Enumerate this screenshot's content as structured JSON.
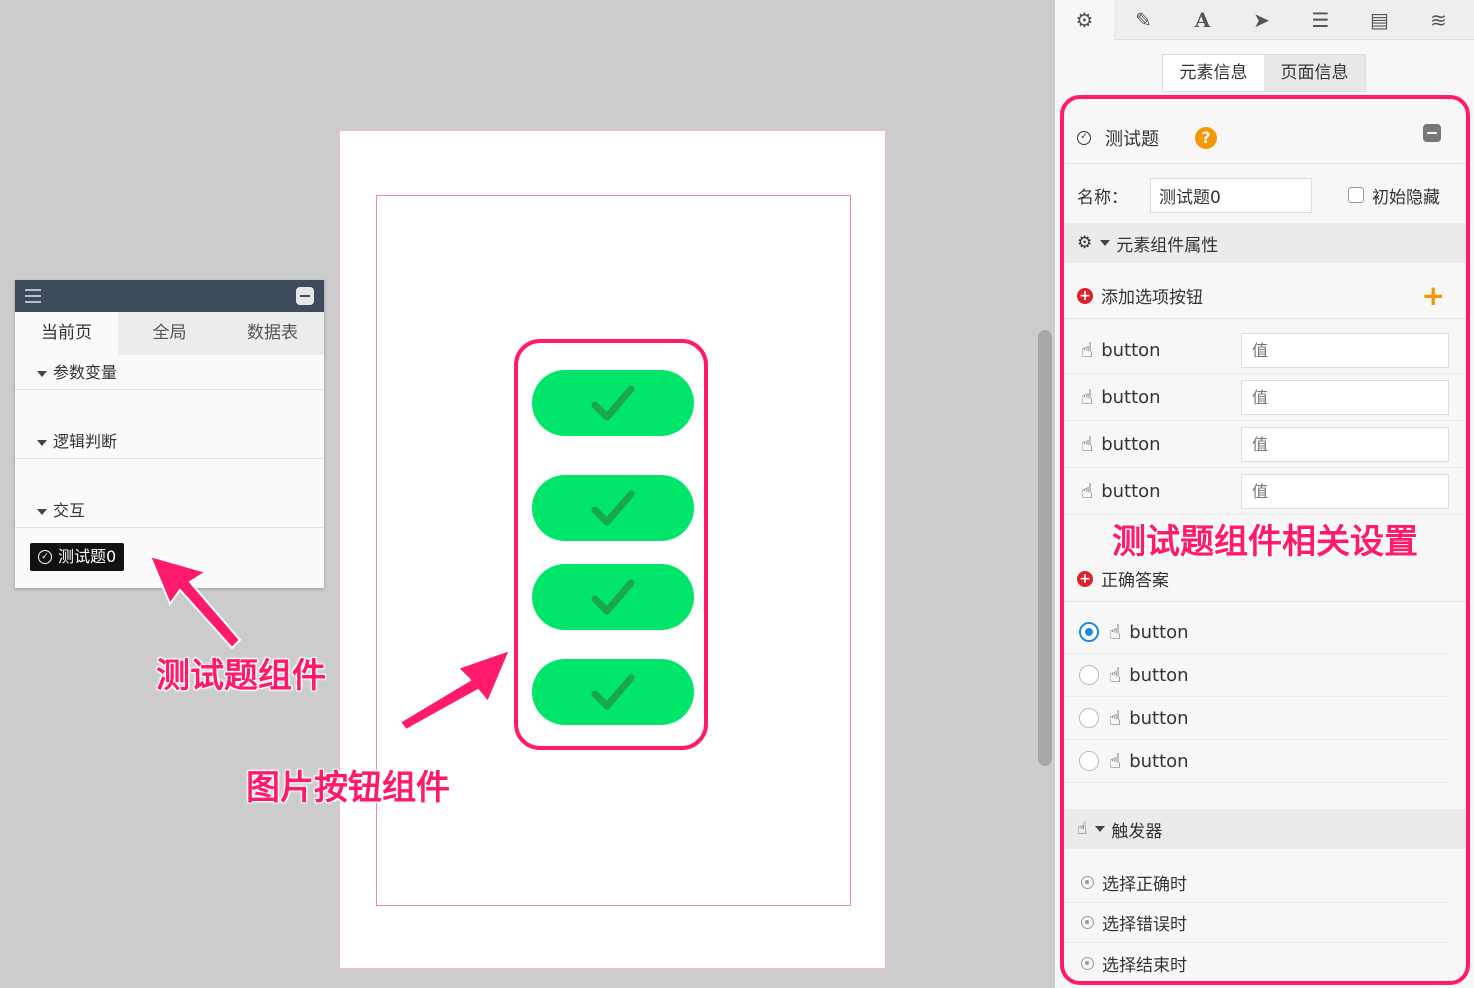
{
  "left_panel": {
    "tabs": [
      "当前页",
      "全局",
      "数据表"
    ],
    "sections": [
      "参数变量",
      "逻辑判断",
      "交互"
    ],
    "quiz_item": "测试题0"
  },
  "annotations": {
    "quiz_component": "测试题组件",
    "image_button_component": "图片按钮组件",
    "quiz_settings": "测试题组件相关设置"
  },
  "right_panel": {
    "toolbar_icons": [
      "gear-icon",
      "pencil-icon",
      "text-icon",
      "send-icon",
      "list-icon",
      "document-icon",
      "database-icon"
    ],
    "info_tabs": [
      "元素信息",
      "页面信息"
    ],
    "title": "测试题",
    "name_label": "名称：",
    "name_value": "测试题0",
    "hide_label": "初始隐藏",
    "component_props": "元素组件属性",
    "add_option": "添加选项按钮",
    "options": [
      {
        "label": "button",
        "value_placeholder": "值"
      },
      {
        "label": "button",
        "value_placeholder": "值"
      },
      {
        "label": "button",
        "value_placeholder": "值"
      },
      {
        "label": "button",
        "value_placeholder": "值"
      }
    ],
    "correct_answer": "正确答案",
    "answers": [
      {
        "label": "button",
        "selected": true
      },
      {
        "label": "button",
        "selected": false
      },
      {
        "label": "button",
        "selected": false
      },
      {
        "label": "button",
        "selected": false
      }
    ],
    "trigger": "触发器",
    "triggers": [
      "选择正确时",
      "选择错误时",
      "选择结束时"
    ]
  },
  "colors": {
    "accent_pink": "#ff1a6b",
    "button_green": "#00e56a",
    "check_green": "#1aa84a",
    "radio_blue": "#1e88e5",
    "help_orange": "#f39800"
  }
}
